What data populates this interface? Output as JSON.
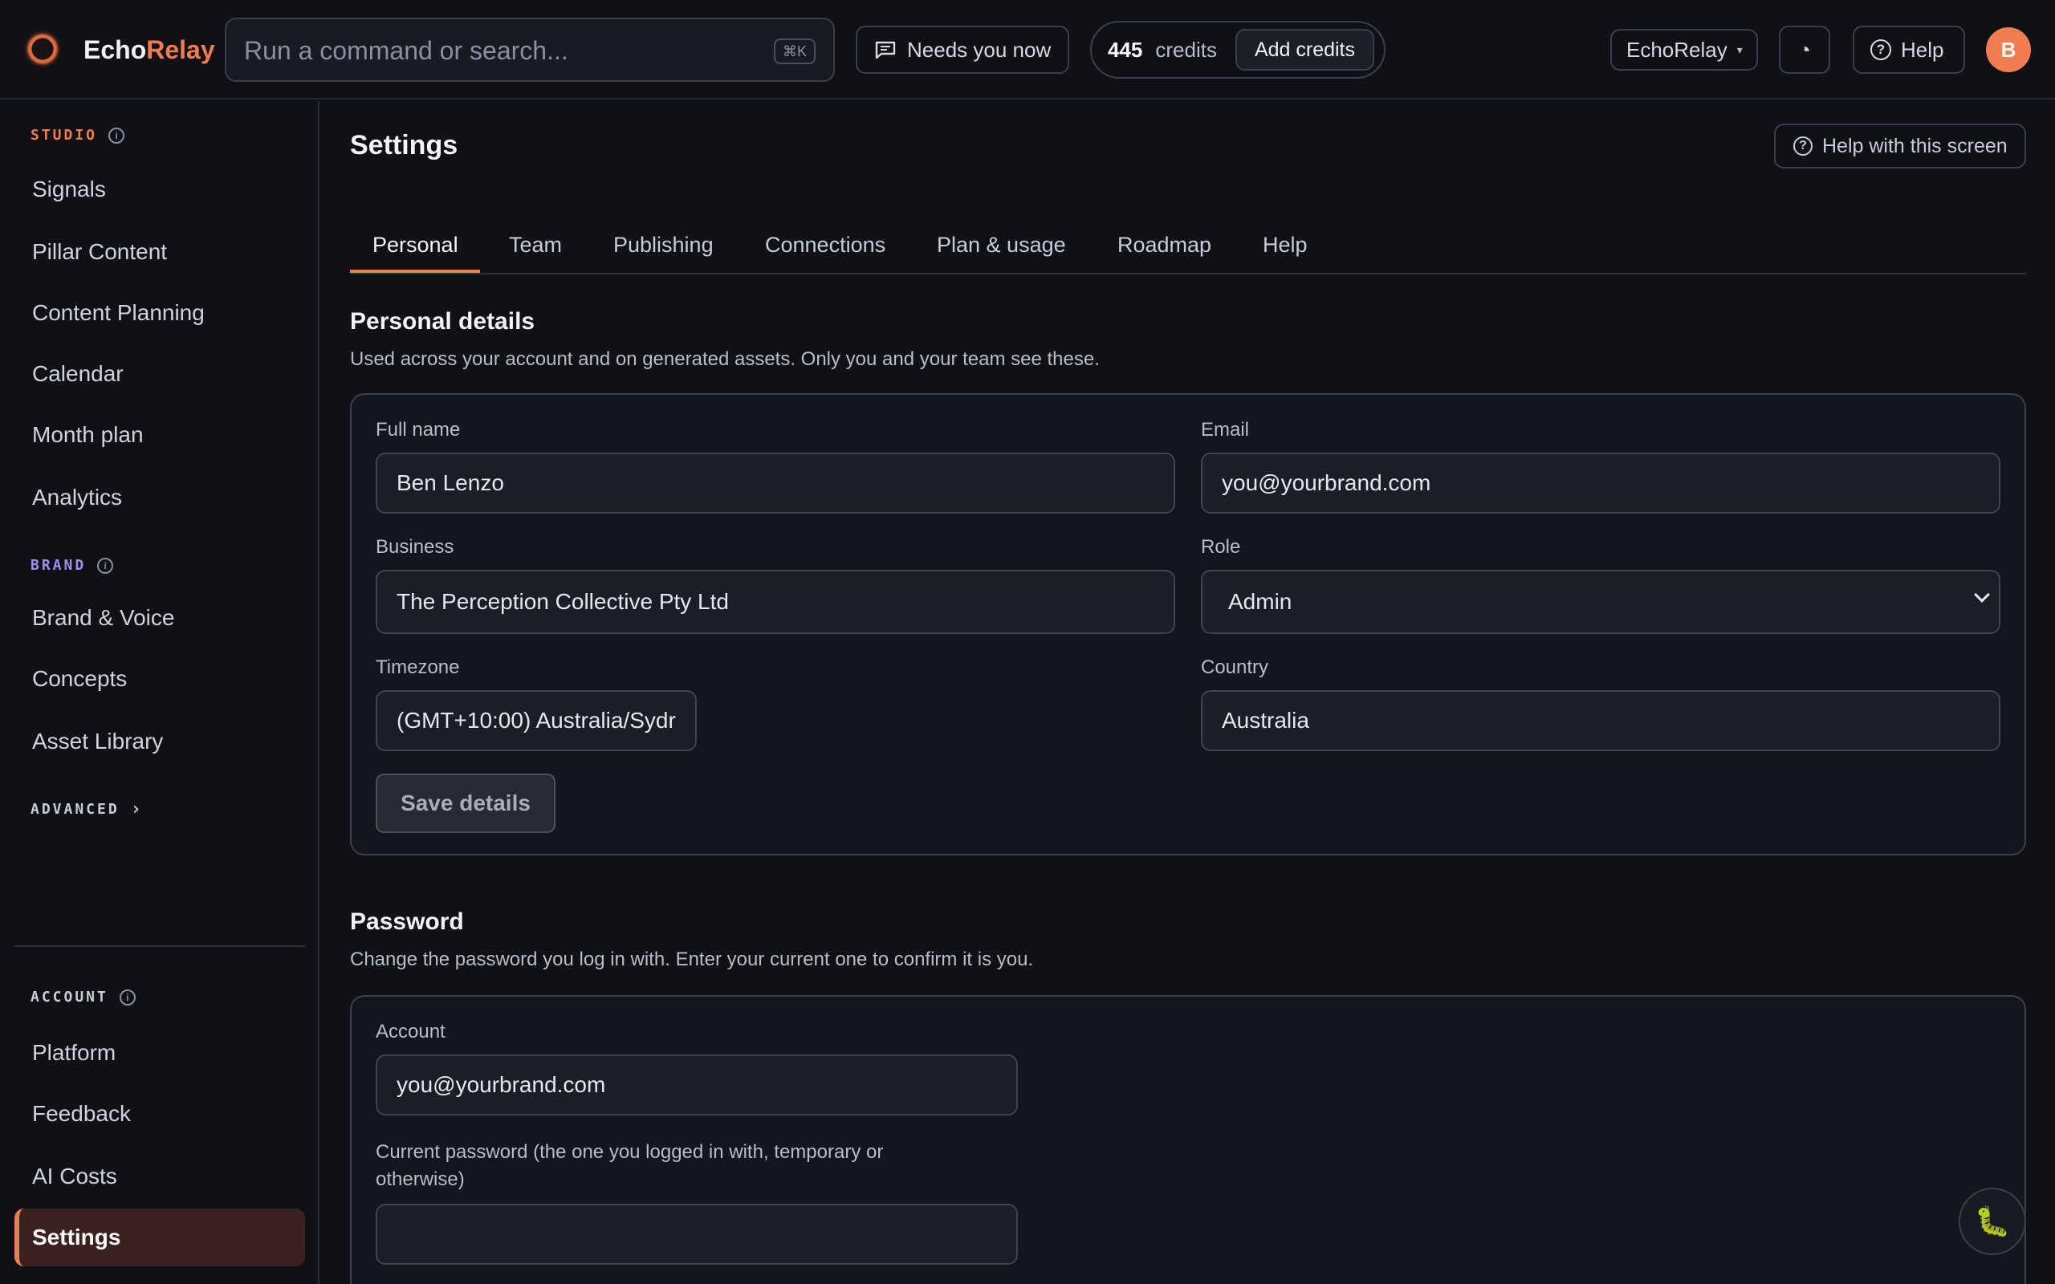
{
  "app": {
    "brand_part1": "Echo",
    "brand_part2": "Relay"
  },
  "topbar": {
    "search_placeholder": "Run a command or search...",
    "search_shortcut": "⌘K",
    "needs_label": "Needs you now",
    "credits_count": "445",
    "credits_label": "credits",
    "add_credits_label": "Add credits",
    "workspace": "EchoRelay",
    "theme_icon": "◔",
    "help_label": "Help",
    "avatar_initial": "B"
  },
  "sidebar": {
    "studio_label": "STUDIO",
    "studio_items": [
      "Signals",
      "Pillar Content",
      "Content Planning",
      "Calendar",
      "Month plan",
      "Analytics"
    ],
    "brand_label": "BRAND",
    "brand_items": [
      "Brand & Voice",
      "Concepts",
      "Asset Library"
    ],
    "advanced_label": "ADVANCED",
    "advanced_chevron": "›",
    "account_label": "ACCOUNT",
    "account_items": [
      "Platform",
      "Feedback",
      "AI Costs"
    ],
    "active_item": "Settings"
  },
  "main": {
    "title": "Settings",
    "help_screen_label": "Help with this screen",
    "tabs": [
      "Personal",
      "Team",
      "Publishing",
      "Connections",
      "Plan & usage",
      "Roadmap",
      "Help"
    ],
    "personal": {
      "heading": "Personal details",
      "description": "Used across your account and on generated assets. Only you and your team see these.",
      "full_name_label": "Full name",
      "full_name_value": "Ben Lenzo",
      "email_label": "Email",
      "email_value": "you@yourbrand.com",
      "business_label": "Business",
      "business_value": "The Perception Collective Pty Ltd",
      "role_label": "Role",
      "role_value": "Admin",
      "timezone_label": "Timezone",
      "timezone_value": "(GMT+10:00) Australia/Sydr",
      "country_label": "Country",
      "country_value": "Australia",
      "save_label": "Save details"
    },
    "password": {
      "heading": "Password",
      "description": "Change the password you log in with. Enter your current one to confirm it is you.",
      "account_label": "Account",
      "account_value": "you@yourbrand.com",
      "current_label_line1": "Current password (the one you logged in with, temporary or",
      "current_label_line2": "otherwise)",
      "current_value": ""
    },
    "fab_icon": "🐛"
  }
}
